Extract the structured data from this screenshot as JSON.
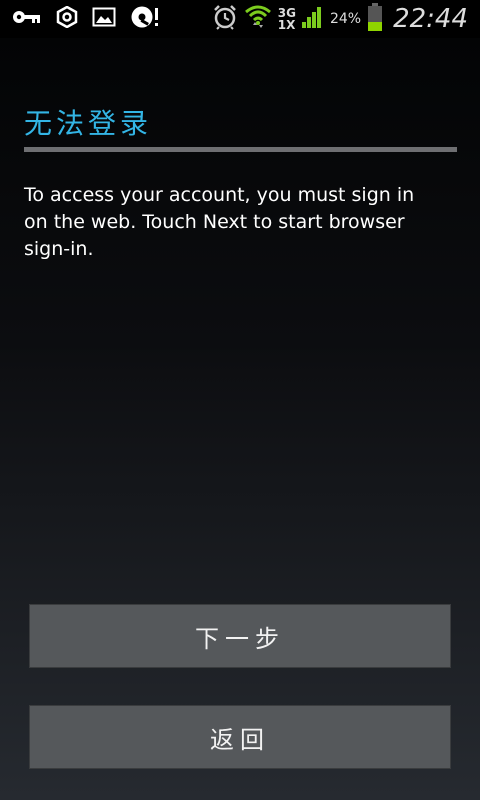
{
  "status_bar": {
    "left_icons": [
      "key-icon",
      "settings-nut-icon",
      "image-icon",
      "disk-alert-icon"
    ],
    "right_icons": [
      "alarm-clock-icon",
      "wifi-icon",
      "signal-icon",
      "battery-icon"
    ],
    "network_type_top": "3G",
    "network_type_bottom": "1X",
    "battery_percent": "24%",
    "time": "22:44"
  },
  "dialog": {
    "title": "无法登录",
    "message": "To access your account, you must sign in on the web. Touch Next to start browser sign-in.",
    "next_button_label": "下一步",
    "back_button_label": "返回"
  },
  "colors": {
    "title_accent": "#33b5e5",
    "button_bg": "#55585b",
    "wifi_green": "#7ccc1e",
    "battery_green": "#8fd400"
  }
}
